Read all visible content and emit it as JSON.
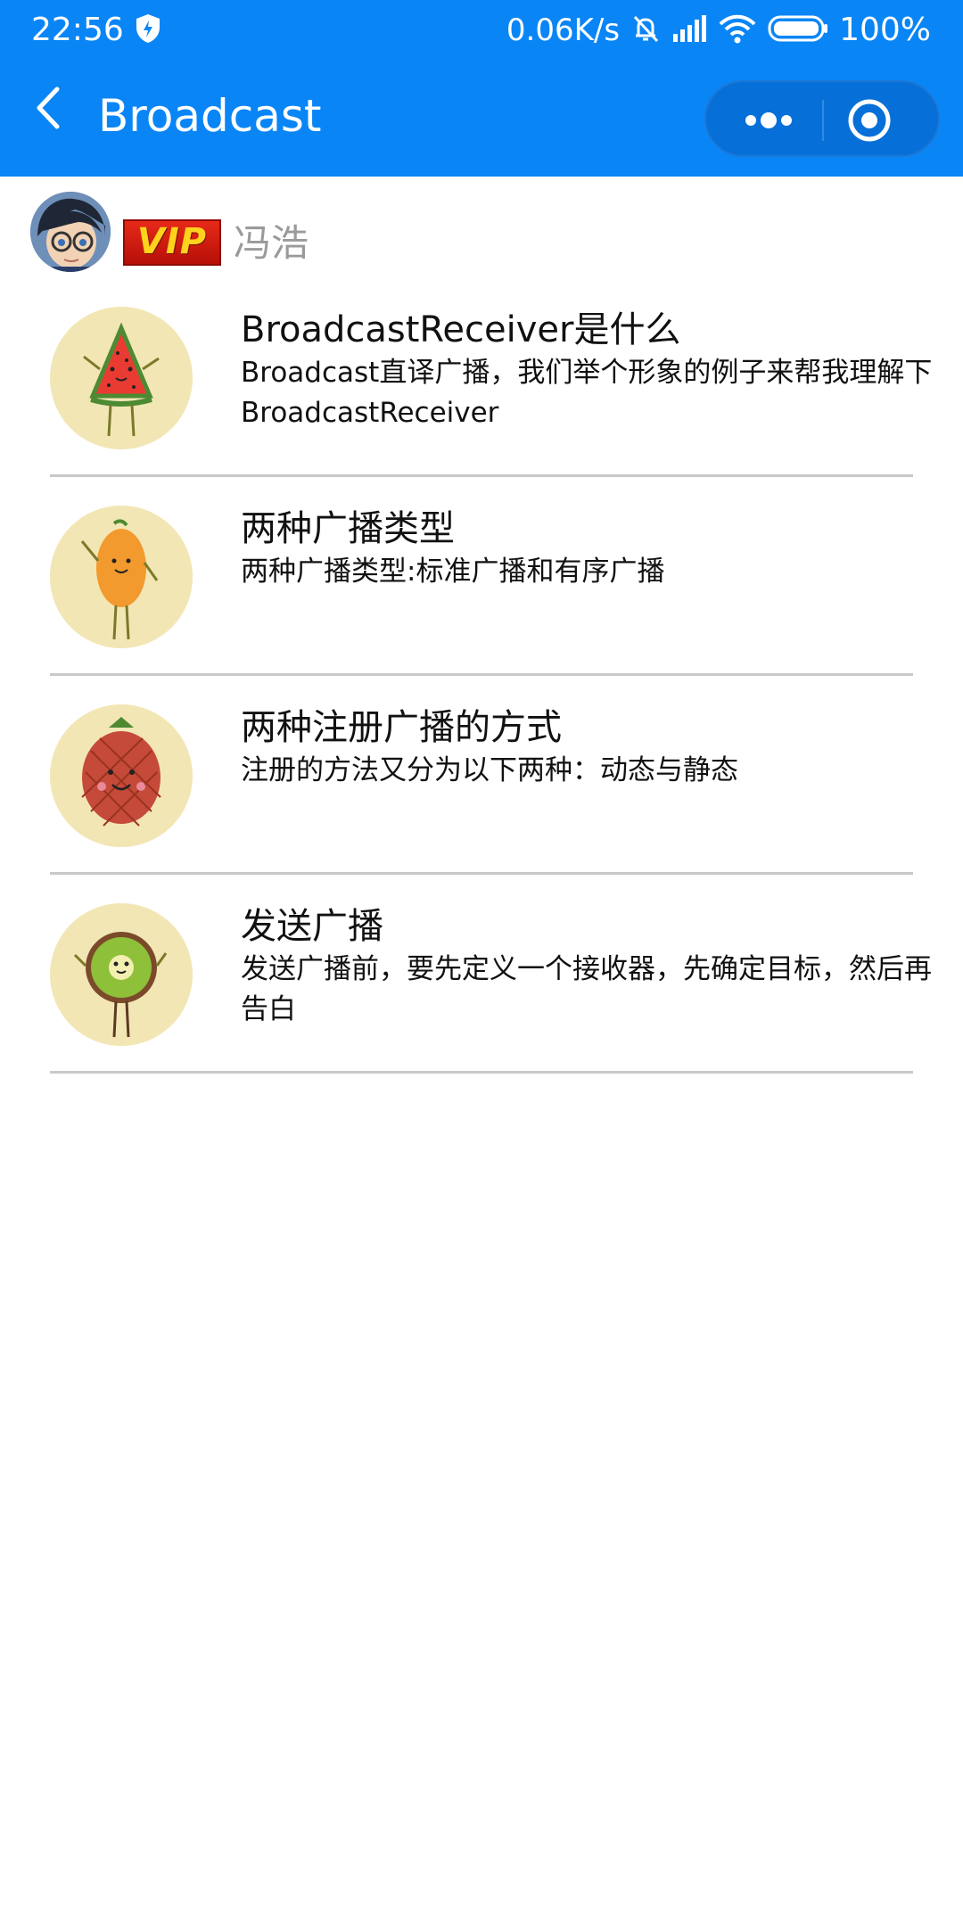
{
  "status_bar": {
    "time": "22:56",
    "network_speed": "0.06K/s",
    "battery": "100%"
  },
  "nav": {
    "title": "Broadcast"
  },
  "user": {
    "badge": "VIP",
    "name": "冯浩"
  },
  "courses": [
    {
      "title": " BroadcastReceiver是什么",
      "description": "Broadcast直译广播，我们举个形象的例子来帮我理解下BroadcastReceiver",
      "icon": "watermelon-icon"
    },
    {
      "title": "两种广播类型",
      "description": "两种广播类型:标准广播和有序广播",
      "icon": "mango-icon"
    },
    {
      "title": "两种注册广播的方式",
      "description": "注册的方法又分为以下两种：动态与静态",
      "icon": "pineapple-icon"
    },
    {
      "title": "发送广播",
      "description": "发送广播前，要先定义一个接收器，先确定目标，然后再告白",
      "icon": "kiwi-icon"
    }
  ],
  "colors": {
    "header": "#0a85f6",
    "capsule": "#0670d8",
    "thumb_bg": "#f3e6b5",
    "divider": "#c9c9c9"
  }
}
